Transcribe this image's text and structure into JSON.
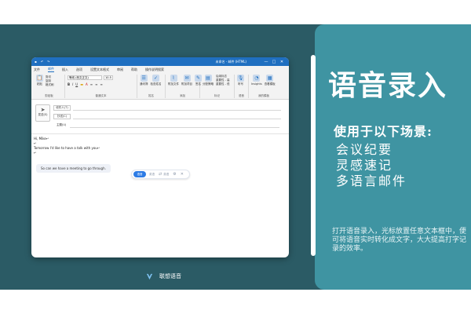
{
  "colors": {
    "band": "#2b5b65",
    "panel": "#3f94a2",
    "outlook_blue": "#1f6fc0",
    "voice_accent": "#2c7be5"
  },
  "promo": {
    "title": "语音录入",
    "subtitle": "使用于以下场景:",
    "scenes": [
      "会议纪要",
      "灵感速记",
      "多语言邮件"
    ],
    "description": "打开语音录入，光标放置任意文本框中，便可将语音实时转化成文字，大大提高打字记录的效率。"
  },
  "window": {
    "doc_title": "未命名 - 邮件 (HTML)",
    "minimize": "—",
    "maximize": "□",
    "close": "✕",
    "menus": [
      "文件",
      "邮件",
      "插入",
      "选项",
      "设置文本格式",
      "审阅",
      "帮助",
      "操作说明搜索"
    ],
    "active_menu_index": 1,
    "ribbon": {
      "clipboard": {
        "paste": "粘贴",
        "cut": "剪切",
        "copy": "复制",
        "format_painter": "格式刷",
        "label": "剪贴板"
      },
      "basic_text": {
        "font": "等线 (西文正文)",
        "size": "10.5",
        "bold": "B",
        "italic": "I",
        "underline": "U",
        "label": "普通文本"
      },
      "names": {
        "address_book": "通讯簿",
        "check_names": "检查姓名",
        "label": "姓名"
      },
      "include": {
        "attach_file": "附加文件",
        "attach_item": "附加项目",
        "signature": "签名",
        "label": "添加"
      },
      "tags": {
        "assign_policy": "分配策略",
        "follow_up": "后续标志",
        "high_importance": "重要性 - 高",
        "low_importance": "重要性 - 低",
        "label": "标记"
      },
      "voice": {
        "dictate": "听写",
        "label": "语音"
      },
      "addins": {
        "insights": "Insights",
        "viewing": "查看模板",
        "label": "我的模板"
      }
    }
  },
  "compose": {
    "send": "发送(S)",
    "to": "收件人(T)",
    "cc": "抄送(C)",
    "subject": "主题(U)",
    "body_lines": [
      "Hi, Mike↵",
      "↵",
      "Tomorrow I'd like to have a talk with you↵",
      "↵"
    ],
    "bubble": "So can we have a meeting to go through."
  },
  "voice_toolbar": {
    "active": "语音",
    "item1": "英语",
    "item2": "英语",
    "settings_icon": "⚙",
    "close_icon": "✕"
  },
  "brand": {
    "name": "联想语音"
  }
}
